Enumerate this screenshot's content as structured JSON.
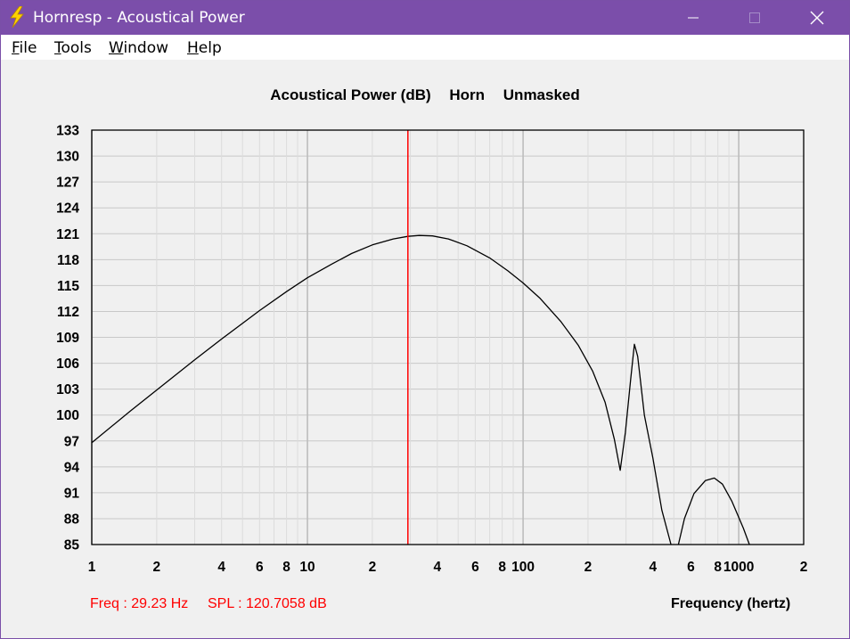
{
  "window": {
    "title": "Hornresp - Acoustical Power"
  },
  "menu": {
    "items": [
      {
        "key": "F",
        "rest": "ile"
      },
      {
        "key": "T",
        "rest": "ools"
      },
      {
        "key": "W",
        "rest": "indow"
      },
      {
        "key": "H",
        "rest": "elp"
      }
    ]
  },
  "colors": {
    "titlebar": "#7b4eaa",
    "cursor": "#ff0000",
    "curve": "#000000",
    "grid": "#c8c8c8"
  },
  "readout": {
    "freq": "Freq : 29.23 Hz",
    "spl": "SPL : 120.7058 dB"
  },
  "chart_data": {
    "type": "line",
    "title_parts": [
      "Acoustical Power (dB)",
      "Horn",
      "Unmasked"
    ],
    "xlabel": "Frequency (hertz)",
    "ylabel": "",
    "xscale": "log",
    "xlim": [
      1,
      2000
    ],
    "ylim": [
      85,
      133
    ],
    "yticks": [
      133,
      130,
      127,
      124,
      121,
      118,
      115,
      112,
      109,
      106,
      103,
      100,
      97,
      94,
      91,
      88,
      85
    ],
    "xticks": [
      {
        "v": 1,
        "label": "1"
      },
      {
        "v": 2,
        "label": "2"
      },
      {
        "v": 4,
        "label": "4"
      },
      {
        "v": 6,
        "label": "6"
      },
      {
        "v": 8,
        "label": "8"
      },
      {
        "v": 10,
        "label": "10"
      },
      {
        "v": 20,
        "label": "2"
      },
      {
        "v": 40,
        "label": "4"
      },
      {
        "v": 60,
        "label": "6"
      },
      {
        "v": 80,
        "label": "8"
      },
      {
        "v": 100,
        "label": "100"
      },
      {
        "v": 200,
        "label": "2"
      },
      {
        "v": 400,
        "label": "4"
      },
      {
        "v": 600,
        "label": "6"
      },
      {
        "v": 800,
        "label": "8"
      },
      {
        "v": 1000,
        "label": "1000"
      },
      {
        "v": 2000,
        "label": "2"
      }
    ],
    "cursor_x": 29.23,
    "series": [
      {
        "segments": [
          [
            [
              1,
              96.8
            ],
            [
              1.5,
              100.4
            ],
            [
              2,
              102.9
            ],
            [
              3,
              106.4
            ],
            [
              4,
              108.8
            ],
            [
              6,
              112.1
            ],
            [
              8,
              114.3
            ],
            [
              10,
              115.9
            ],
            [
              13,
              117.5
            ],
            [
              16,
              118.7
            ],
            [
              20,
              119.7
            ],
            [
              25,
              120.4
            ],
            [
              29.23,
              120.7
            ],
            [
              33,
              120.8
            ],
            [
              38,
              120.75
            ],
            [
              45,
              120.4
            ],
            [
              55,
              119.6
            ],
            [
              70,
              118.2
            ],
            [
              85,
              116.7
            ],
            [
              100,
              115.3
            ],
            [
              120,
              113.5
            ],
            [
              150,
              110.8
            ],
            [
              180,
              108.1
            ],
            [
              210,
              105.1
            ],
            [
              240,
              101.5
            ],
            [
              265,
              97.2
            ],
            [
              282,
              93.6
            ],
            [
              298,
              98.0
            ],
            [
              315,
              104.0
            ],
            [
              328,
              108.2
            ],
            [
              340,
              106.8
            ],
            [
              365,
              100.0
            ],
            [
              400,
              95.0
            ],
            [
              440,
              89.0
            ],
            [
              485,
              85.0
            ]
          ],
          [
            [
              525,
              85.0
            ],
            [
              560,
              88.0
            ],
            [
              620,
              90.9
            ],
            [
              700,
              92.4
            ],
            [
              770,
              92.7
            ],
            [
              840,
              92.0
            ],
            [
              930,
              90.0
            ],
            [
              1050,
              86.9
            ],
            [
              1120,
              85.0
            ]
          ]
        ]
      }
    ]
  }
}
